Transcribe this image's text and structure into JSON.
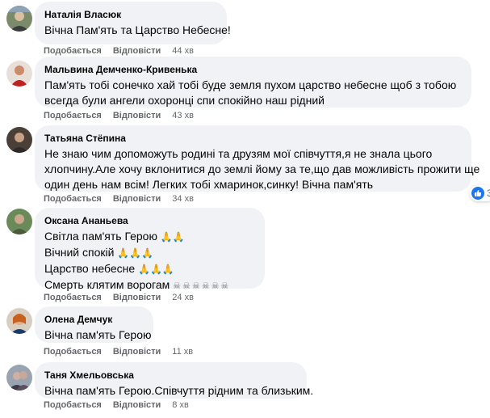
{
  "actions": {
    "like": "Подобається",
    "reply": "Відповісти"
  },
  "comments": [
    {
      "author": "Наталія Власюк",
      "lines": [
        "Вічна Пам'ять та Царство Небесне!"
      ],
      "time": "44 хв"
    },
    {
      "author": "Мальвина Демченко-Кривенька",
      "lines": [
        "Пам'ять тобі сонечко хай тобі буде земля пухом царство небесне щоб з тобою",
        "всегда були ангели охоронці спи спокійно наш рідний"
      ],
      "time": "43 хв"
    },
    {
      "author": "Татьяна Стёпина",
      "lines": [
        "Не знаю чим допоможуть родині та друзям мої співчуття,я не знала цього",
        "хлопчину.Але хочу вклонитися до землі йому за те,що дав можливість прожити ще",
        "один день нам всім! Легких тобі хмаринок,синку! Вічна пам'ять"
      ],
      "time": "34 хв",
      "reactions": "3"
    },
    {
      "author": "Оксана Ананьева",
      "lines": [
        "Світла пам'ять Герою",
        "Вічний спокій",
        "Царство небесне",
        "Смерть клятим ворогам"
      ],
      "emojis": [
        "🙏🙏",
        "🙏🙏🙏",
        "🙏🙏🙏",
        "☠☠☠☠☠☠"
      ],
      "time": "24 хв"
    },
    {
      "author": "Олена Демчук",
      "lines": [
        "Вічна пам'ять Герою"
      ],
      "time": "11 хв"
    },
    {
      "author": "Таня Хмельовська",
      "lines": [
        "Вічна пам'ять Герою.Співчуття рідним та близьким."
      ],
      "time": "8 хв"
    }
  ],
  "colors": {
    "bubble": "#f0f2f5",
    "meta": "#65676b",
    "like_blue": "#1877f2"
  }
}
